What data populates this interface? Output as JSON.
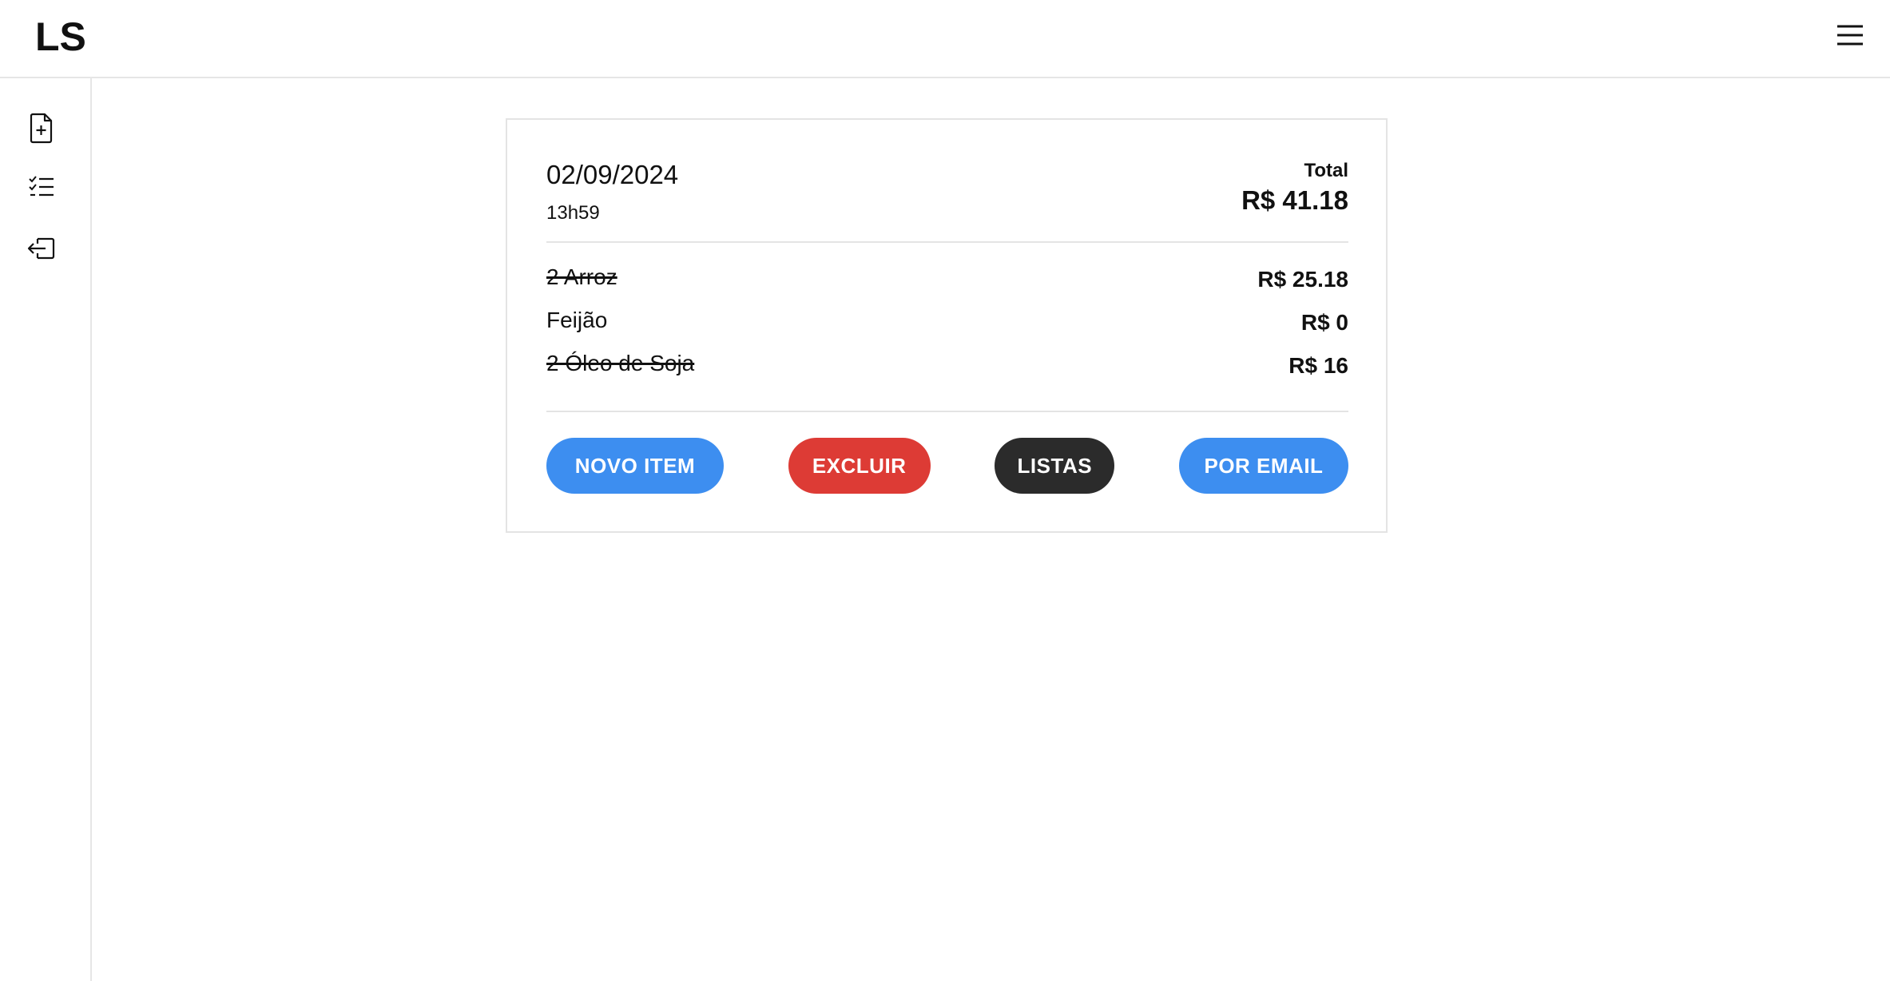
{
  "header": {
    "logo": "LS",
    "menu_icon": "hamburger-menu-icon"
  },
  "sidebar": {
    "items": [
      {
        "icon": "file-plus-icon"
      },
      {
        "icon": "checklist-icon"
      },
      {
        "icon": "logout-icon"
      }
    ]
  },
  "list": {
    "date": "02/09/2024",
    "time": "13h59",
    "total_label": "Total",
    "total_value": "R$ 41.18",
    "items": [
      {
        "name": "2 Arroz",
        "price": "R$ 25.18",
        "checked": true
      },
      {
        "name": "Feijão",
        "price": "R$ 0",
        "checked": false
      },
      {
        "name": "2 Óleo de Soja",
        "price": "R$ 16",
        "checked": true
      }
    ]
  },
  "actions": {
    "new_item": {
      "label": "NOVO ITEM",
      "color": "#3d8ef0"
    },
    "delete": {
      "label": "EXCLUIR",
      "color": "#dd3b35"
    },
    "lists": {
      "label": "LISTAS",
      "color": "#2b2b2b"
    },
    "email": {
      "label": "POR EMAIL",
      "color": "#3d8ef0"
    }
  }
}
